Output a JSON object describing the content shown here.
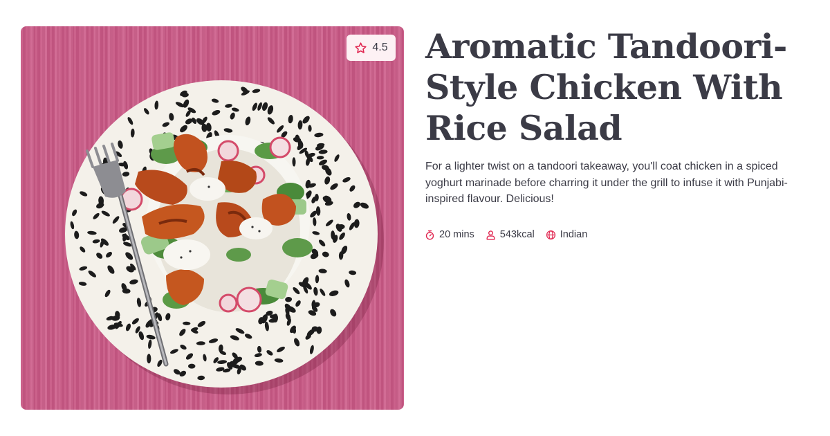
{
  "recipe": {
    "title": "Aromatic Tandoori-Style Chicken With Rice Salad",
    "description": "For a lighter twist on a tandoori takeaway, you'll coat chicken in a spiced yoghurt marinade before charring it under the grill to infuse it with Punjabi-inspired flavour. Delicious!",
    "rating": "4.5",
    "rating_icon": "star-icon",
    "meta": [
      {
        "icon": "timer-icon",
        "label": "20 mins"
      },
      {
        "icon": "person-icon",
        "label": "543kcal"
      },
      {
        "icon": "globe-icon",
        "label": "Indian"
      }
    ]
  },
  "colors": {
    "accent": "#e0254f",
    "text": "#3b3b46",
    "photo_background": "#cc5b88",
    "rating_background": "#fdf1f4"
  }
}
